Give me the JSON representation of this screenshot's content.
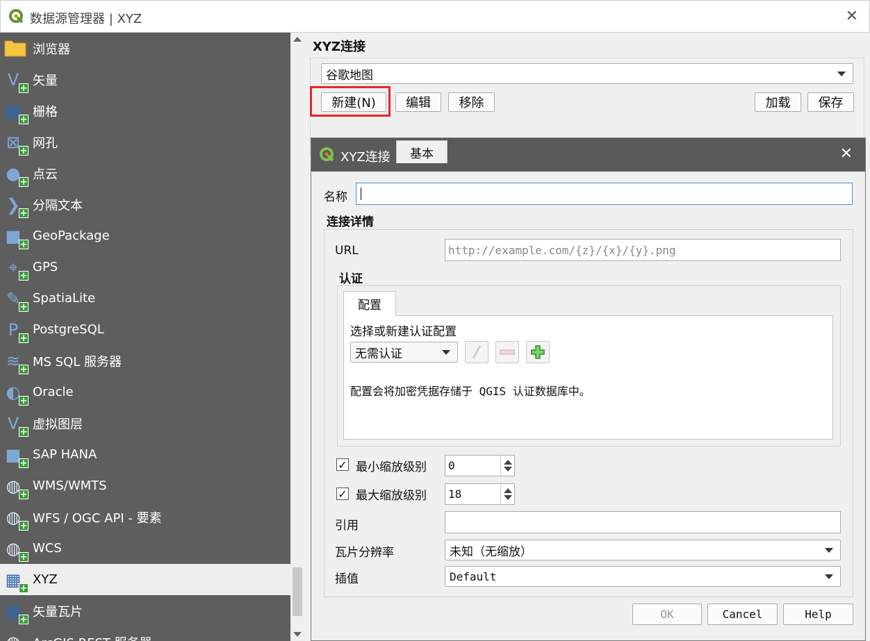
{
  "window": {
    "title": "数据源管理器 | XYZ",
    "close_glyph": "✕"
  },
  "sidebar": {
    "items": [
      {
        "label": "浏览器",
        "icon": "folder-icon"
      },
      {
        "label": "矢量",
        "icon": "vector-icon"
      },
      {
        "label": "栅格",
        "icon": "raster-icon"
      },
      {
        "label": "网孔",
        "icon": "mesh-icon"
      },
      {
        "label": "点云",
        "icon": "point-cloud-icon"
      },
      {
        "label": "分隔文本",
        "icon": "delimited-text-icon"
      },
      {
        "label": "GeoPackage",
        "icon": "geopackage-icon"
      },
      {
        "label": "GPS",
        "icon": "gps-icon"
      },
      {
        "label": "SpatiaLite",
        "icon": "spatialite-icon"
      },
      {
        "label": "PostgreSQL",
        "icon": "postgresql-icon"
      },
      {
        "label": "MS SQL 服务器",
        "icon": "mssql-icon"
      },
      {
        "label": "Oracle",
        "icon": "oracle-icon"
      },
      {
        "label": "虚拟图层",
        "icon": "virtual-layer-icon"
      },
      {
        "label": "SAP HANA",
        "icon": "saphana-icon"
      },
      {
        "label": "WMS/WMTS",
        "icon": "wms-icon"
      },
      {
        "label": "WFS / OGC API - 要素",
        "icon": "wfs-icon"
      },
      {
        "label": "WCS",
        "icon": "wcs-icon"
      },
      {
        "label": "XYZ",
        "icon": "xyz-icon"
      },
      {
        "label": "矢量瓦片",
        "icon": "vector-tile-icon"
      },
      {
        "label": "ArcGIS REST 服务器",
        "icon": "arcgis-rest-icon"
      }
    ],
    "active": "XYZ"
  },
  "main": {
    "group_title": "XYZ连接",
    "connection_selected": "谷歌地图",
    "buttons": {
      "new": "新建(N)",
      "edit": "编辑",
      "remove": "移除",
      "load": "加载",
      "save": "保存"
    }
  },
  "dialog": {
    "title": "XYZ连接",
    "name_label": "名称",
    "name_value": "",
    "details_title": "连接详情",
    "url_label": "URL",
    "url_placeholder": "http://example.com/{z}/{x}/{y}.png",
    "auth_title": "认证",
    "tabs": [
      "配置",
      "基本"
    ],
    "auth_select_label": "选择或新建认证配置",
    "auth_combo_value": "无需认证",
    "auth_note": "配置会将加密凭据存储于 QGIS 认证数据库中。",
    "min_zoom_label": "最小缩放级别",
    "min_zoom_value": "0",
    "min_zoom_checked": true,
    "max_zoom_label": "最大缩放级别",
    "max_zoom_value": "18",
    "max_zoom_checked": true,
    "referer_label": "引用",
    "referer_value": "",
    "tile_res_label": "瓦片分辨率",
    "tile_res_value": "未知（无缩放）",
    "interp_label": "插值",
    "interp_value": "Default",
    "ok": "OK",
    "cancel": "Cancel",
    "help": "Help"
  },
  "colors": {
    "sidebar_bg": "#5e5e5e",
    "highlight": "#e8242c",
    "qgis_green": "#589632",
    "plus_green": "#3a9c38"
  }
}
